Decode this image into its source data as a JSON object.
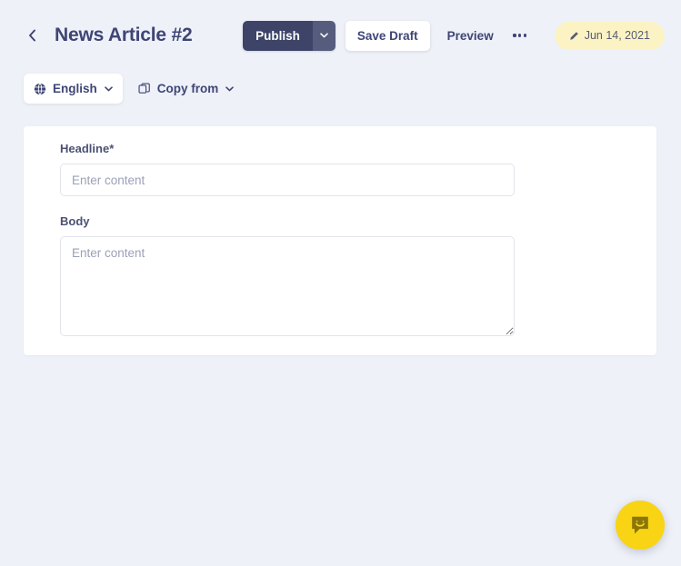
{
  "header": {
    "back_icon": "chevron-left-icon",
    "title": "News Article #2",
    "publish_label": "Publish",
    "publish_caret_icon": "chevron-down-icon",
    "save_draft_label": "Save Draft",
    "preview_label": "Preview",
    "more_icon": "ellipsis-icon",
    "date_badge": {
      "icon": "pencil-icon",
      "label": "Jun 14, 2021"
    }
  },
  "toolbar": {
    "language": {
      "icon": "globe-icon",
      "label": "English",
      "caret_icon": "chevron-down-icon"
    },
    "copy_from": {
      "icon": "copy-icon",
      "label": "Copy from",
      "caret_icon": "chevron-down-icon"
    }
  },
  "form": {
    "fields": [
      {
        "label": "Headline",
        "required_marker": "*",
        "placeholder": "Enter content",
        "value": ""
      },
      {
        "label": "Body",
        "required_marker": "",
        "placeholder": "Enter content",
        "value": ""
      }
    ]
  },
  "chat": {
    "icon": "chat-bubble-smile-icon"
  },
  "colors": {
    "page_background": "#eef1f8",
    "card_background": "#ffffff",
    "text_primary": "#3f4575",
    "publish_primary": "#3d4468",
    "publish_caret": "#565c7d",
    "date_badge_background": "#fbf3c4",
    "chat_accent": "#f8d414",
    "input_border": "#e2e4ec",
    "placeholder": "#9ba1b8"
  }
}
